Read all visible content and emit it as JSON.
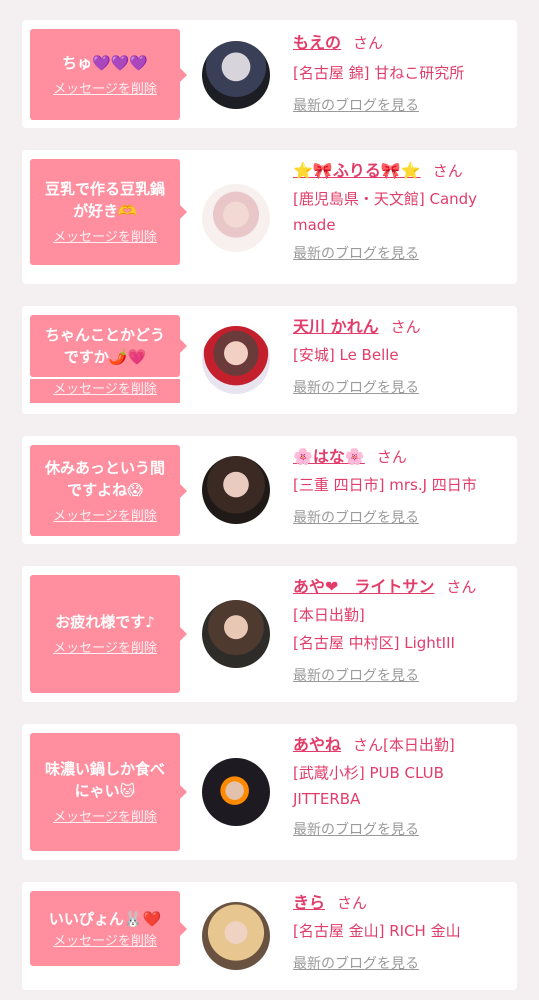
{
  "common": {
    "delete_label": "メッセージを削除",
    "san": "さん",
    "blog_link": "最新のブログを見る"
  },
  "cards": [
    {
      "message": "ちゅ💜💜💜",
      "name": "もえの",
      "shop_lines": [
        "[名古屋 錦] 甘ねこ研究所"
      ]
    },
    {
      "message": "豆乳で作る豆乳鍋が好き🫶",
      "name": "⭐🎀ふりる🎀⭐",
      "shop_lines": [
        "[鹿児島県・天文館] Candy made"
      ]
    },
    {
      "message": "ちゃんことかどうですか🌶️💗",
      "name": "天川 かれん",
      "shop_lines": [
        "[安城] Le Belle"
      ]
    },
    {
      "message": "休みあっという間ですよね😱",
      "name": "🌸はな🌸",
      "shop_lines": [
        "[三重 四日市] mrs.J 四日市"
      ]
    },
    {
      "message": "お疲れ様です♪",
      "name": "あや❤︎　ライトサン",
      "shop_lines": [
        "[本日出勤]",
        "[名古屋 中村区] LightIII"
      ]
    },
    {
      "message": "味濃い鍋しか食べにゃい🐱",
      "name": "あやね",
      "name_suffix": "[本日出勤]",
      "shop_lines": [
        "[武蔵小杉] PUB CLUB JITTERBA"
      ]
    },
    {
      "message": "いいぴょん🐰❤️",
      "name": "きら",
      "shop_lines": [
        "[名古屋 金山] RICH 金山"
      ]
    }
  ]
}
